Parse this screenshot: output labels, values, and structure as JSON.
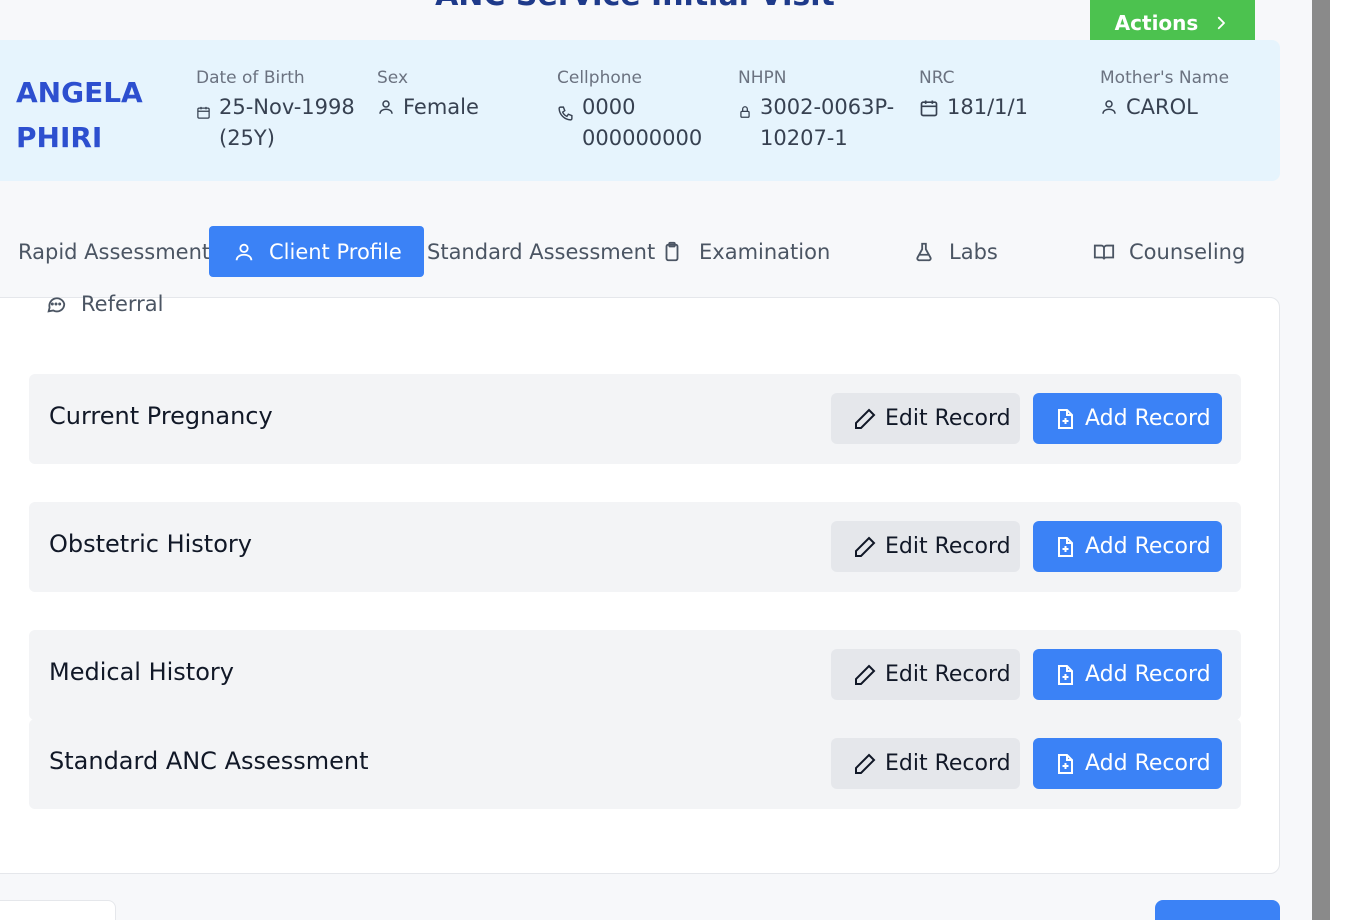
{
  "page": {
    "title": "ANC Service Initial Visit"
  },
  "header": {
    "actions_label": "Actions"
  },
  "patient": {
    "name_first": "ANGELA",
    "name_last": "PHIRI",
    "dob_label": "Date of Birth",
    "dob_value": "25-Nov-1998",
    "age": "(25Y)",
    "sex_label": "Sex",
    "sex_value": "Female",
    "cell_label": "Cellphone",
    "cell_line1": "0000",
    "cell_line2": "000000000",
    "nhpn_label": "NHPN",
    "nhpn_line1": "3002-0063P-",
    "nhpn_line2": "10207-1",
    "nrc_label": "NRC",
    "nrc_value": "181/1/1",
    "mother_label": "Mother's Name",
    "mother_value": "CAROL"
  },
  "tabs": [
    {
      "label": "Rapid Assessment",
      "icon": "none",
      "active": false
    },
    {
      "label": "Client Profile",
      "icon": "user-icon",
      "active": true
    },
    {
      "label": "Standard Assessment",
      "icon": "none",
      "active": false
    },
    {
      "label": "Examination",
      "icon": "clipboard-icon",
      "active": false
    },
    {
      "label": "Labs",
      "icon": "flask-icon",
      "active": false
    },
    {
      "label": "Counseling",
      "icon": "book-icon",
      "active": false
    },
    {
      "label": "Referral",
      "icon": "chat-icon",
      "active": false
    }
  ],
  "sections": [
    {
      "title": "Current Pregnancy",
      "edit_label": "Edit Record",
      "add_label": "Add Record"
    },
    {
      "title": "Obstetric History",
      "edit_label": "Edit Record",
      "add_label": "Add Record"
    },
    {
      "title": "Medical History",
      "edit_label": "Edit Record",
      "add_label": "Add Record"
    },
    {
      "title": "Standard ANC Assessment",
      "edit_label": "Edit Record",
      "add_label": "Add Record"
    }
  ],
  "colors": {
    "accent": "#3b82f6",
    "action": "#4cc24f",
    "name": "#2d4fcf",
    "banner": "#e6f4fd"
  }
}
